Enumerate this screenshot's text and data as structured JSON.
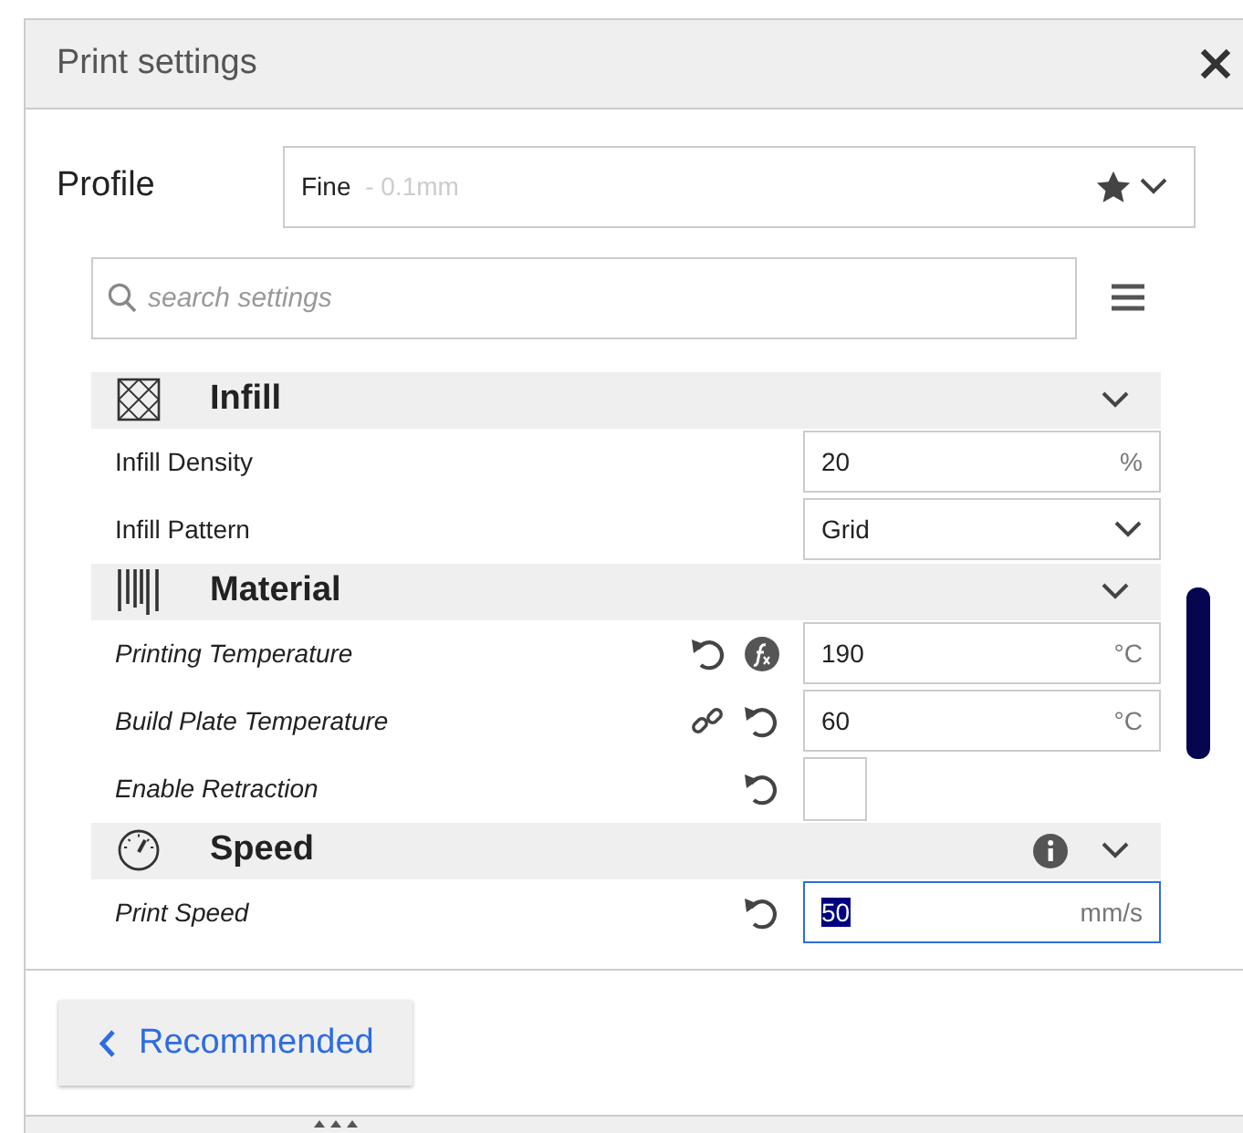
{
  "window": {
    "title": "Print settings"
  },
  "profile": {
    "label": "Profile",
    "name": "Fine",
    "detail": " - 0.1mm",
    "favorite": true
  },
  "search": {
    "placeholder": "search settings"
  },
  "sections": [
    {
      "title": "Infill",
      "settings": [
        {
          "kind": "input",
          "label": "Infill Density",
          "italic": false,
          "value": "20",
          "unit": "%",
          "focused": false
        },
        {
          "kind": "select",
          "label": "Infill Pattern",
          "italic": false,
          "value": "Grid"
        }
      ]
    },
    {
      "title": "Material",
      "settings": [
        {
          "kind": "input",
          "label": "Printing Temperature",
          "italic": true,
          "actions": [
            {
              "kind": "revert"
            },
            {
              "kind": "formula"
            }
          ],
          "value": "190",
          "unit": "°C",
          "focused": false
        },
        {
          "kind": "input",
          "label": "Build Plate Temperature",
          "italic": true,
          "actions": [
            {
              "kind": "link"
            },
            {
              "kind": "revert"
            }
          ],
          "value": "60",
          "unit": "°C",
          "focused": false
        },
        {
          "kind": "checkbox",
          "label": "Enable Retraction",
          "italic": true,
          "actions": [
            {
              "kind": "revert"
            }
          ],
          "checked": false
        }
      ]
    },
    {
      "title": "Speed",
      "actions": [
        {
          "kind": "info"
        }
      ],
      "settings": [
        {
          "kind": "input",
          "label": "Print Speed",
          "italic": true,
          "actions": [
            {
              "kind": "revert"
            }
          ],
          "value": "50",
          "unit": "mm/s",
          "focused": true
        }
      ]
    }
  ],
  "back_button": {
    "label": "Recommended"
  }
}
